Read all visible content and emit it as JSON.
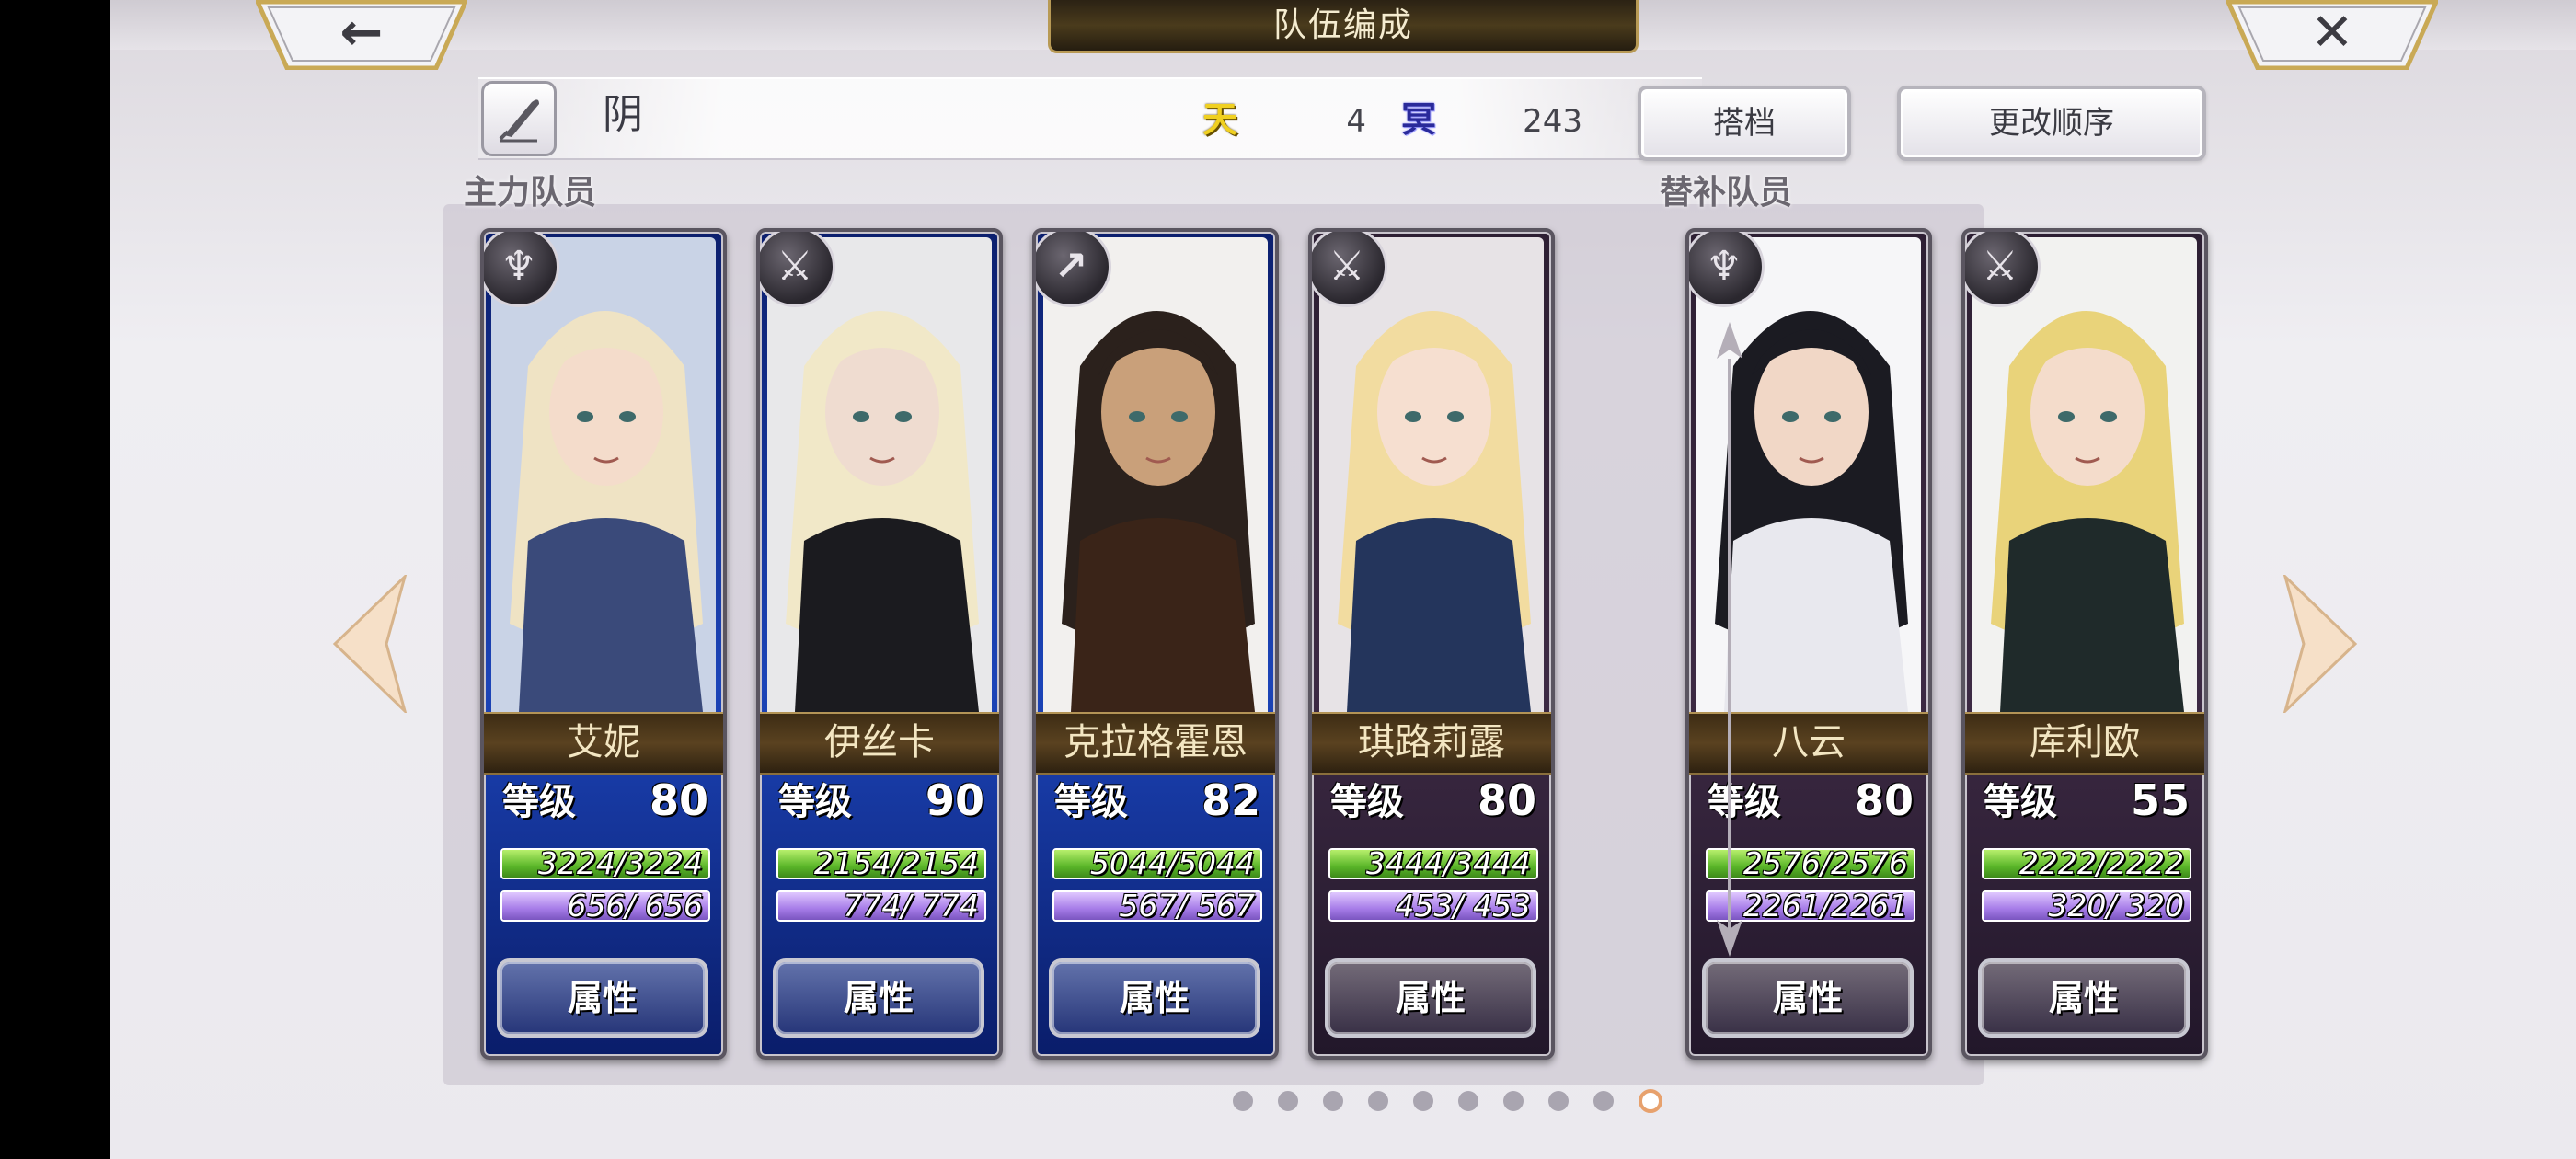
{
  "header": {
    "title": "队伍编成",
    "back_glyph": "←",
    "close_glyph": "✕"
  },
  "team": {
    "name": "阴",
    "sky_icon": "天",
    "sky_value": "4",
    "dark_icon": "冥",
    "dark_value": "243",
    "partner_button": "搭档",
    "order_button": "更改顺序"
  },
  "sections": {
    "main_label": "主力队员",
    "sub_label": "替补队员"
  },
  "level_label": "等级",
  "attr_button": "属性",
  "members": [
    {
      "name": "艾妮",
      "weapon": "staff-icon",
      "level": "80",
      "hp": "3224/3224",
      "mp": " 656/ 656",
      "hp_fraction": 1.0,
      "mp_fraction": 1.0,
      "card_theme": "blue"
    },
    {
      "name": "伊丝卡",
      "weapon": "sword-icon",
      "level": "90",
      "hp": "2154/2154",
      "mp": " 774/ 774",
      "hp_fraction": 1.0,
      "mp_fraction": 1.0,
      "card_theme": "blue"
    },
    {
      "name": "克拉格霍恩",
      "weapon": "spear-icon",
      "level": "82",
      "hp": "5044/5044",
      "mp": " 567/ 567",
      "hp_fraction": 1.0,
      "mp_fraction": 1.0,
      "card_theme": "blue"
    },
    {
      "name": "琪路莉露",
      "weapon": "sword-icon",
      "level": "80",
      "hp": "3444/3444",
      "mp": " 453/ 453",
      "hp_fraction": 1.0,
      "mp_fraction": 1.0,
      "card_theme": "dark"
    }
  ],
  "reserves": [
    {
      "name": "八云",
      "weapon": "staff-icon",
      "level": "80",
      "hp": "2576/2576",
      "mp": "2261/2261",
      "hp_fraction": 1.0,
      "mp_fraction": 1.0,
      "card_theme": "dark"
    },
    {
      "name": "库利欧",
      "weapon": "sword-icon",
      "level": "55",
      "hp": "2222/2222",
      "mp": " 320/ 320",
      "hp_fraction": 1.0,
      "mp_fraction": 1.0,
      "card_theme": "dark"
    }
  ],
  "pagination": {
    "total": 10,
    "current": 10
  }
}
